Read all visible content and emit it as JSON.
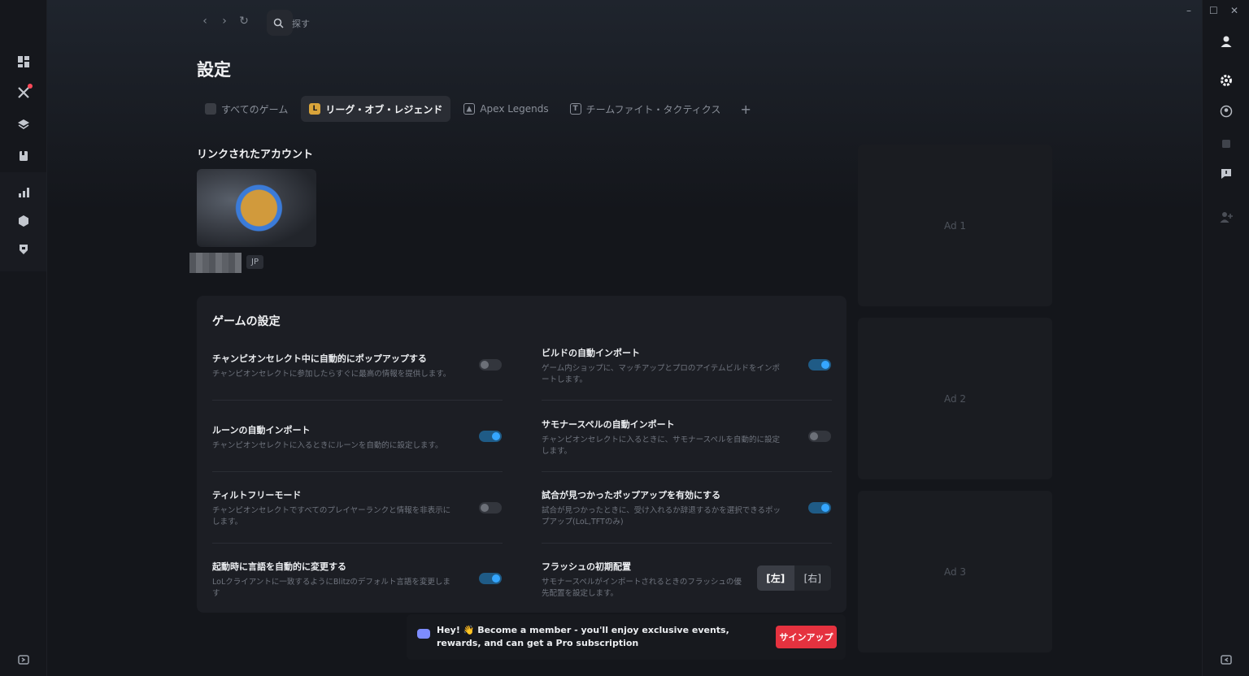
{
  "window": {
    "minimize": "–",
    "maximize": "☐",
    "close": "✕"
  },
  "nav": {
    "back": "‹",
    "forward": "›",
    "refresh": "↻"
  },
  "search": {
    "placeholder": "探す"
  },
  "page_title": "設定",
  "tabs": [
    {
      "label": "すべてのゲーム",
      "icon": "all-games-icon"
    },
    {
      "label": "リーグ・オブ・レジェンド",
      "icon": "league-of-legends-icon",
      "active": true
    },
    {
      "label": "Apex Legends",
      "icon": "apex-icon"
    },
    {
      "label": "チームファイト・タクティクス",
      "icon": "tft-icon"
    }
  ],
  "tab_add": "+",
  "linked_accounts": {
    "title": "リンクされたアカウント",
    "region": "JP"
  },
  "game_settings": {
    "title": "ゲームの設定",
    "items": [
      {
        "title": "チャンピオンセレクト中に自動的にポップアップする",
        "desc": "チャンピオンセレクトに参加したらすぐに最高の情報を提供します。",
        "enabled": false
      },
      {
        "title": "ビルドの自動インポート",
        "desc": "ゲーム内ショップに、マッチアップとプロのアイテムビルドをインポートします。",
        "enabled": true
      },
      {
        "title": "ルーンの自動インポート",
        "desc": "チャンピオンセレクトに入るときにルーンを自動的に設定します。",
        "enabled": true
      },
      {
        "title": "サモナースペルの自動インポート",
        "desc": "チャンピオンセレクトに入るときに、サモナースペルを自動的に設定します。",
        "enabled": false
      },
      {
        "title": "ティルトフリーモード",
        "desc": "チャンピオンセレクトですべてのプレイヤーランクと情報を非表示にします。",
        "enabled": false
      },
      {
        "title": "試合が見つかったポップアップを有効にする",
        "desc": "試合が見つかったときに、受け入れるか辞退するかを選択できるポップアップ(LoL,TFTのみ)",
        "enabled": true
      },
      {
        "title": "起動時に言語を自動的に変更する",
        "desc": "LoLクライアントに一致するようにBlitzのデフォルト言語を変更します",
        "enabled": true
      },
      {
        "title": "フラッシュの初期配置",
        "desc": "サモナースペルがインポートされるときのフラッシュの優先配置を設定します。"
      }
    ],
    "flash_options": [
      "[左]",
      "[右]"
    ],
    "flash_selected": "[左]"
  },
  "ads": [
    "Ad 1",
    "Ad 2",
    "Ad 3"
  ],
  "toast": {
    "text": "Hey! 👋 Become a member - you'll enjoy exclusive events, rewards, and can get a Pro subscription",
    "button": "サインアップ"
  },
  "colors": {
    "accent": "#35a6ff",
    "signup": "#e5323f",
    "background": "#14161b"
  }
}
